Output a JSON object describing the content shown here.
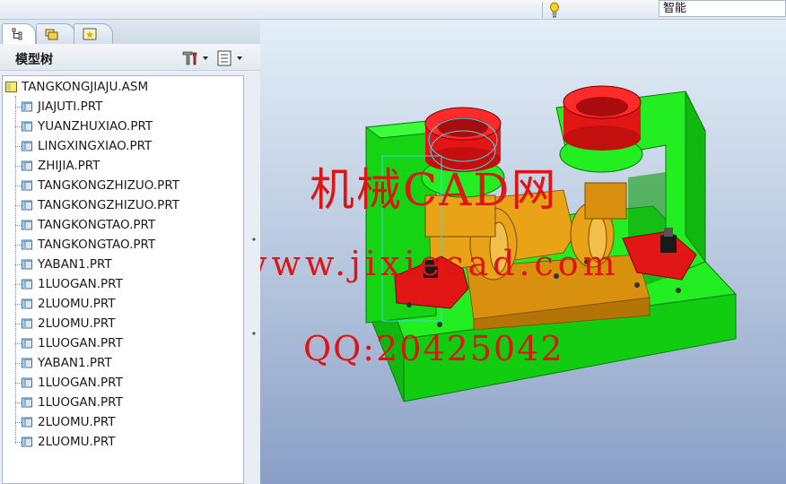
{
  "toolbar": {
    "smart_filter_value": "智能"
  },
  "panel": {
    "title": "模型树",
    "tabs": [
      {
        "name": "model-tree-tab",
        "icon": "tree-icon"
      },
      {
        "name": "folder-browser-tab",
        "icon": "folder-icon"
      },
      {
        "name": "favorites-tab",
        "icon": "star-icon"
      }
    ],
    "buttons": [
      {
        "name": "settings-button",
        "icon": "tools-icon"
      },
      {
        "name": "show-button",
        "icon": "list-icon"
      }
    ]
  },
  "tree": {
    "root": "TANGKONGJIAJU.ASM",
    "items": [
      "JIAJUTI.PRT",
      "YUANZHUXIAO.PRT",
      "LINGXINGXIAO.PRT",
      "ZHIJIA.PRT",
      "TANGKONGZHIZUO.PRT",
      "TANGKONGZHIZUO.PRT",
      "TANGKONGTAO.PRT",
      "TANGKONGTAO.PRT",
      "YABAN1.PRT",
      "1LUOGAN.PRT",
      "2LUOMU.PRT",
      "2LUOMU.PRT",
      "1LUOGAN.PRT",
      "YABAN1.PRT",
      "1LUOGAN.PRT",
      "1LUOGAN.PRT",
      "2LUOMU.PRT",
      "2LUOMU.PRT"
    ]
  },
  "watermark": {
    "line1": "机械CAD网",
    "line2": "www.jixiecad.com",
    "line3": "QQ:20425042"
  },
  "colors": {
    "fixture_body": "#19e619",
    "support_parts": "#d9900f",
    "bushings": "#e31616",
    "watermark": "#e01414"
  }
}
